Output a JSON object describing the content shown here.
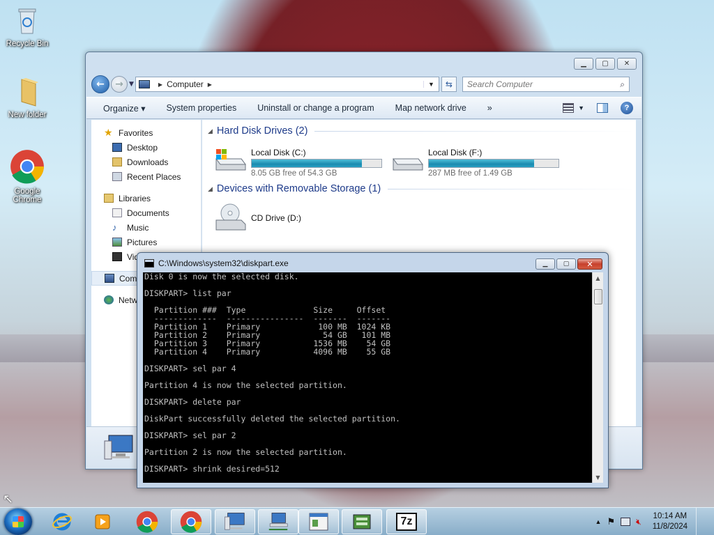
{
  "desktop": {
    "icons": [
      {
        "label": "Recycle Bin",
        "icon": "recycle-bin-icon"
      },
      {
        "label": "New folder",
        "icon": "folder-icon"
      },
      {
        "label": "Google Chrome",
        "icon": "chrome-icon"
      }
    ]
  },
  "explorer": {
    "address": {
      "root_label": "Computer"
    },
    "search": {
      "placeholder": "Search Computer"
    },
    "toolbar": {
      "organize": "Organize ▾",
      "system_properties": "System properties",
      "uninstall": "Uninstall or change a program",
      "map_drive": "Map network drive",
      "more": "»"
    },
    "navpane": {
      "favorites": {
        "label": "Favorites",
        "items": [
          "Desktop",
          "Downloads",
          "Recent Places"
        ]
      },
      "libraries": {
        "label": "Libraries",
        "items": [
          "Documents",
          "Music",
          "Pictures",
          "Videos"
        ]
      },
      "computer": "Computer",
      "network": "Network"
    },
    "groups": {
      "hdd": {
        "title": "Hard Disk Drives (2)",
        "drives": [
          {
            "name": "Local Disk (C:)",
            "free": "8.05 GB free of 54.3 GB",
            "used_fraction": 0.85,
            "icon": "windows-hdd-icon"
          },
          {
            "name": "Local Disk (F:)",
            "free": "287 MB free of 1.49 GB",
            "used_fraction": 0.81,
            "icon": "hdd-icon"
          }
        ]
      },
      "removable": {
        "title": "Devices with Removable Storage (1)",
        "drives": [
          {
            "name": "CD Drive (D:)",
            "icon": "cd-drive-icon"
          }
        ]
      }
    }
  },
  "cmd": {
    "title": "C:\\Windows\\system32\\diskpart.exe",
    "lines": [
      "Disk 0 is now the selected disk.",
      "",
      "DISKPART> list par",
      "",
      "  Partition ###  Type              Size     Offset",
      "  -------------  ----------------  -------  -------",
      "  Partition 1    Primary            100 MB  1024 KB",
      "  Partition 2    Primary             54 GB   101 MB",
      "  Partition 3    Primary           1536 MB    54 GB",
      "  Partition 4    Primary           4096 MB    55 GB",
      "",
      "DISKPART> sel par 4",
      "",
      "Partition 4 is now the selected partition.",
      "",
      "DISKPART> delete par",
      "",
      "DiskPart successfully deleted the selected partition.",
      "",
      "DISKPART> sel par 2",
      "",
      "Partition 2 is now the selected partition.",
      "",
      "DISKPART> shrink desired=512"
    ]
  },
  "taskbar": {
    "pinned": [
      "internet-explorer-icon",
      "media-player-icon",
      "chrome-icon",
      "chrome-icon",
      "computer-icon",
      "network-computer-icon",
      "control-panel-icon",
      "disk-management-icon",
      "seven-zip-icon"
    ],
    "seven_zip_label": "7z",
    "time": "10:14 AM",
    "date": "11/8/2024"
  }
}
